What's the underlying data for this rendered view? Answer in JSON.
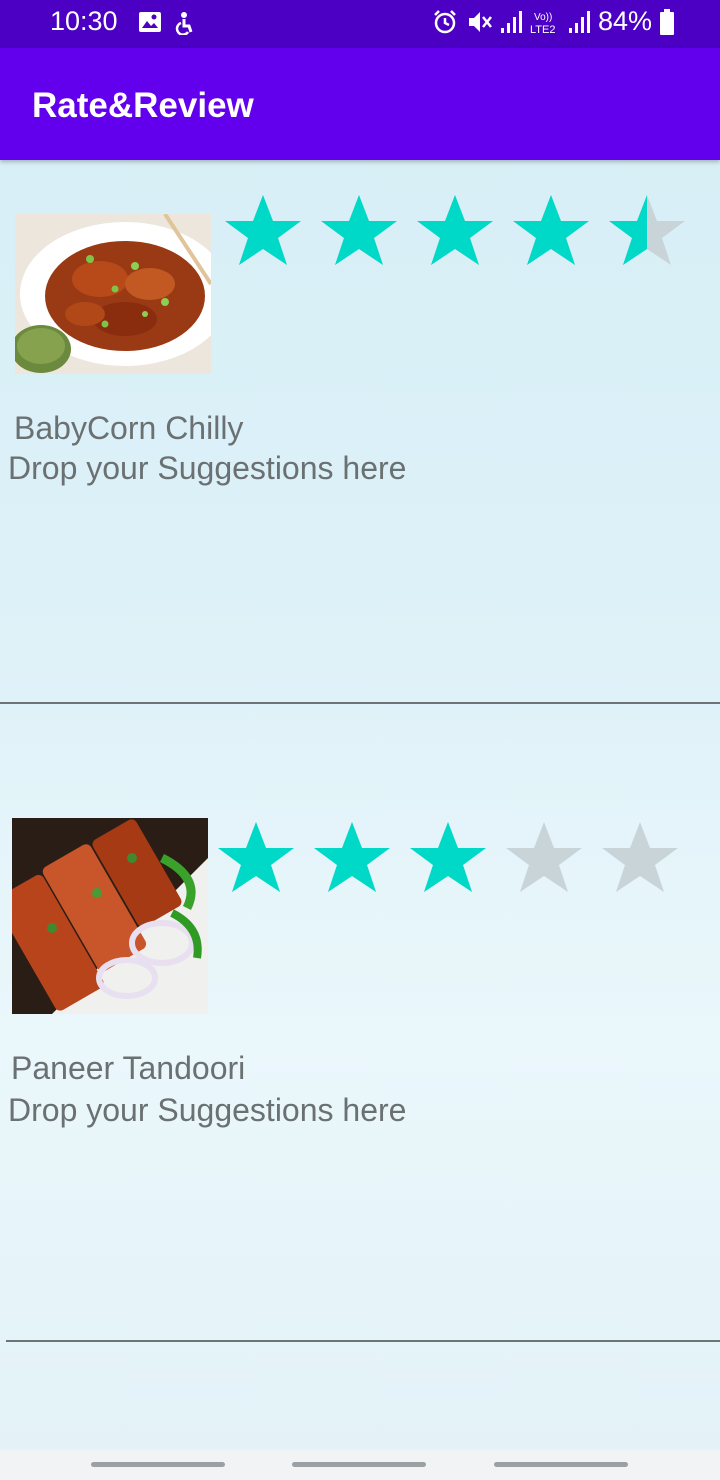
{
  "status_bar": {
    "time": "10:30",
    "battery": "84%",
    "left_icons": [
      "image-icon",
      "accessibility-icon"
    ],
    "right_icons": [
      "alarm-icon",
      "mute-icon",
      "signal-icon",
      "volte-lte2-icon",
      "signal-icon",
      "battery-icon"
    ]
  },
  "app_bar": {
    "title": "Rate&Review"
  },
  "items": [
    {
      "name": "BabyCorn Chilly",
      "rating": 4.5,
      "max_rating": 5,
      "suggestion_placeholder": "Drop your Suggestions here"
    },
    {
      "name": "Paneer Tandoori",
      "rating": 3,
      "max_rating": 5,
      "suggestion_placeholder": "Drop your Suggestions here"
    }
  ],
  "colors": {
    "status_bar": "#4b00c4",
    "app_bar": "#6200ee",
    "star_filled": "#00d8c8",
    "star_empty": "#c9d4d9",
    "text": "#6b7172"
  }
}
